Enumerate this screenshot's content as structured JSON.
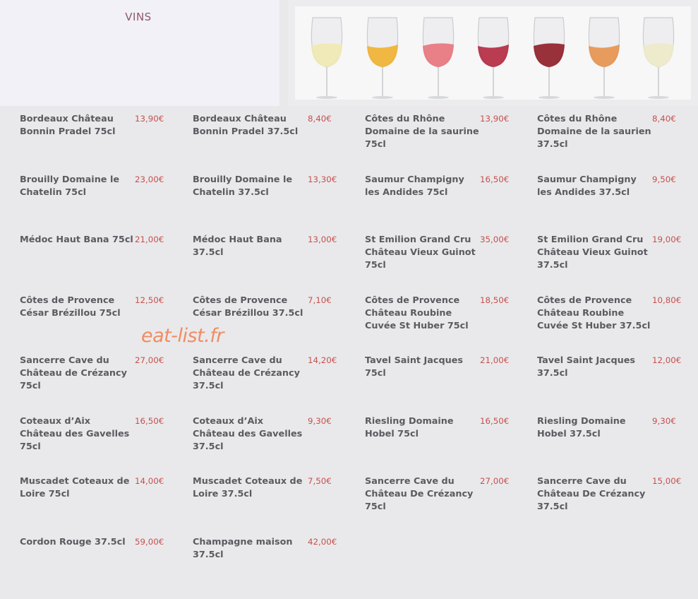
{
  "header": {
    "title": "VINS"
  },
  "watermark": "eat-list.fr",
  "colors": {
    "title": "#8e5868",
    "price": "#c6504d",
    "text": "#5a5a60",
    "watermark": "#f08d63",
    "background": "#e9e9eb"
  },
  "glasses": [
    {
      "icon": "white-wine-glass-icon",
      "color": "#efe9b2"
    },
    {
      "icon": "golden-wine-glass-icon",
      "color": "#f0b12f"
    },
    {
      "icon": "rose-wine-glass-icon",
      "color": "#e8737c"
    },
    {
      "icon": "red-wine-glass-icon",
      "color": "#b3283f"
    },
    {
      "icon": "deep-red-wine-glass-icon",
      "color": "#8f1c27"
    },
    {
      "icon": "amber-wine-glass-icon",
      "color": "#e6924e"
    },
    {
      "icon": "pale-wine-glass-icon",
      "color": "#edeac9"
    }
  ],
  "wines": [
    {
      "name": "Bordeaux Château Bonnin Pradel 75cl",
      "price": "13,90€"
    },
    {
      "name": "Bordeaux Château Bonnin Pradel 37.5cl",
      "price": "8,40€"
    },
    {
      "name": "Côtes du Rhône Domaine de la saurine 75cl",
      "price": "13,90€"
    },
    {
      "name": "Côtes du Rhône Domaine de la saurien 37.5cl",
      "price": "8,40€"
    },
    {
      "name": "Brouilly Domaine le Chatelin 75cl",
      "price": "23,00€"
    },
    {
      "name": "Brouilly Domaine le Chatelin 37.5cl",
      "price": "13,30€"
    },
    {
      "name": "Saumur Champigny les Andides 75cl",
      "price": "16,50€"
    },
    {
      "name": "Saumur Champigny les Andides 37.5cl",
      "price": "9,50€"
    },
    {
      "name": "Médoc Haut Bana 75cl",
      "price": "21,00€"
    },
    {
      "name": "Médoc Haut Bana 37.5cl",
      "price": "13,00€"
    },
    {
      "name": "St Emilion Grand Cru Château Vieux Guinot 75cl",
      "price": "35,00€"
    },
    {
      "name": "St Emilion Grand Cru Château Vieux Guinot 37.5cl",
      "price": "19,00€"
    },
    {
      "name": "Côtes de Provence César Brézillou 75cl",
      "price": "12,50€"
    },
    {
      "name": "Côtes de Provence César Brézillou 37.5cl",
      "price": "7,10€"
    },
    {
      "name": "Côtes de Provence Château Roubine Cuvée St Huber 75cl",
      "price": "18,50€"
    },
    {
      "name": "Côtes de Provence Château Roubine Cuvée St Huber 37.5cl",
      "price": "10,80€"
    },
    {
      "name": "Sancerre Cave du Château de Crézancy 75cl",
      "price": "27,00€"
    },
    {
      "name": "Sancerre Cave du Château de Crézancy 37.5cl",
      "price": "14,20€"
    },
    {
      "name": "Tavel Saint Jacques 75cl",
      "price": "21,00€"
    },
    {
      "name": "Tavel Saint Jacques 37.5cl",
      "price": "12,00€"
    },
    {
      "name": "Coteaux d’Aix Château des Gavelles 75cl",
      "price": "16,50€"
    },
    {
      "name": "Coteaux d’Aix Château des Gavelles 37.5cl",
      "price": "9,30€"
    },
    {
      "name": "Riesling Domaine Hobel 75cl",
      "price": "16,50€"
    },
    {
      "name": "Riesling Domaine Hobel 37.5cl",
      "price": "9,30€"
    },
    {
      "name": "Muscadet Coteaux de Loire 75cl",
      "price": "14,00€"
    },
    {
      "name": "Muscadet Coteaux de Loire 37.5cl",
      "price": "7,50€"
    },
    {
      "name": "Sancerre Cave du Château De Crézancy 75cl",
      "price": "27,00€"
    },
    {
      "name": "Sancerre Cave du Château De Crézancy 37.5cl",
      "price": "15,00€"
    },
    {
      "name": "Cordon Rouge 37.5cl",
      "price": "59,00€"
    },
    {
      "name": "Champagne maison 37.5cl",
      "price": "42,00€"
    }
  ]
}
